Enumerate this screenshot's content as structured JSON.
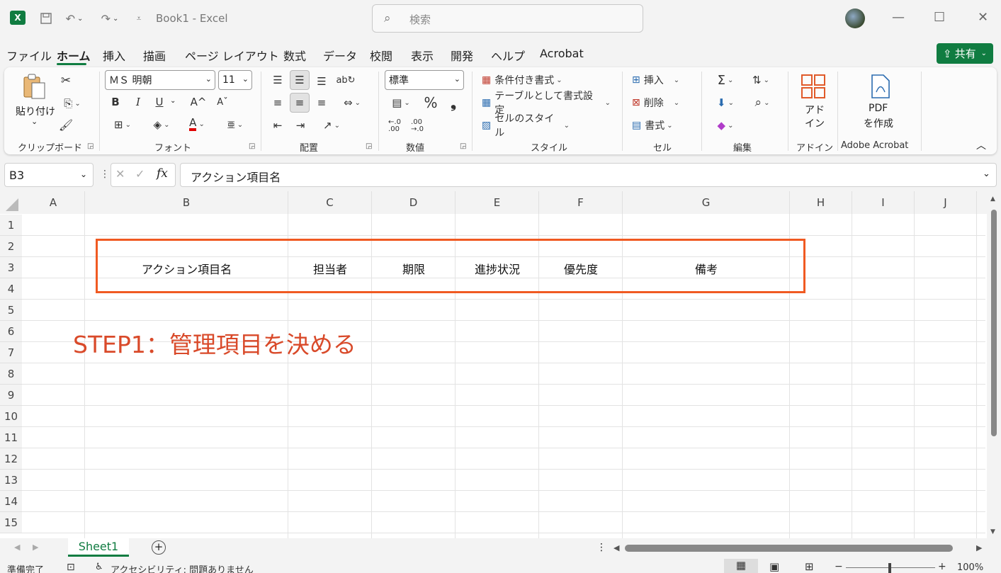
{
  "app": {
    "logo_letter": "X",
    "title": "Book1  -  Excel",
    "search_placeholder": "検索",
    "share_label": "共有"
  },
  "menu": {
    "tabs": [
      "ファイル",
      "ホーム",
      "挿入",
      "描画",
      "ページ レイアウト",
      "数式",
      "データ",
      "校閲",
      "表示",
      "開発",
      "ヘルプ",
      "Acrobat"
    ],
    "active_index": 1
  },
  "ribbon": {
    "clipboard": {
      "paste": "貼り付け",
      "label": "クリップボード"
    },
    "font": {
      "name": "ＭＳ 明朝",
      "size": "11",
      "bold": "B",
      "italic": "I",
      "underline": "U",
      "grow": "A^",
      "shrink": "Aˇ",
      "font_color": "A",
      "furigana": "亜",
      "label": "フォント"
    },
    "alignment": {
      "label": "配置"
    },
    "number": {
      "format": "標準",
      "percent": "%",
      "comma": "❟",
      "inc_decimal": "←.0\n.00",
      "dec_decimal": ".00\n→.0",
      "label": "数値"
    },
    "styles": {
      "conditional": "条件付き書式",
      "table": "テーブルとして書式設定",
      "cell_styles": "セルのスタイル",
      "label": "スタイル"
    },
    "cells": {
      "insert": "挿入",
      "delete": "削除",
      "format": "書式",
      "label": "セル"
    },
    "editing": {
      "label": "編集"
    },
    "addins": {
      "button_line1": "アド",
      "button_line2": "イン",
      "label": "アドイン"
    },
    "acrobat": {
      "button_line1": "PDF",
      "button_line2": "を作成",
      "label": "Adobe Acrobat"
    }
  },
  "formula_bar": {
    "name_box": "B3",
    "fx": "fx",
    "content": "アクション項目名"
  },
  "grid": {
    "columns": [
      "A",
      "B",
      "C",
      "D",
      "E",
      "F",
      "G",
      "H",
      "I",
      "J"
    ],
    "rows": [
      "1",
      "2",
      "3",
      "4",
      "5",
      "6",
      "7",
      "8",
      "9",
      "10",
      "11",
      "12",
      "13",
      "14",
      "15"
    ],
    "row3": {
      "B": "アクション項目名",
      "C": "担当者",
      "D": "期限",
      "E": "進捗状況",
      "F": "優先度",
      "G": "備考"
    },
    "annotation": "STEP1：管理項目を決める",
    "highlight_color": "#f05a22",
    "annotation_color": "#d94a2a"
  },
  "sheets": {
    "tabs": [
      "Sheet1"
    ],
    "add": "+"
  },
  "status": {
    "ready": "準備完了",
    "accessibility": "アクセシビリティ: 問題ありません",
    "zoom": "100%",
    "zoom_minus": "−",
    "zoom_plus": "+"
  },
  "colors": {
    "accent": "#107c41"
  }
}
